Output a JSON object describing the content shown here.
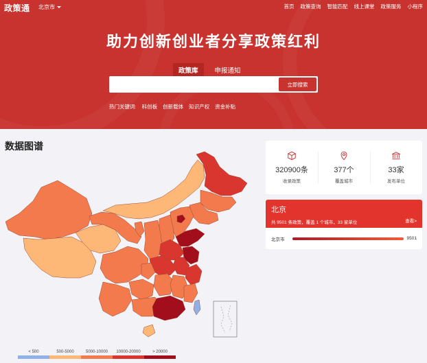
{
  "header": {
    "logo": "政策通",
    "city": "北京市",
    "nav": [
      "首页",
      "政策查询",
      "智能匹配",
      "线上课堂",
      "政策服务",
      "小程序"
    ],
    "headline": "助力创新创业者分享政策红利",
    "tabs": [
      {
        "label": "政策库",
        "active": true
      },
      {
        "label": "申报通知",
        "active": false
      }
    ],
    "search": {
      "value": "",
      "placeholder": "",
      "button": "立即搜索"
    },
    "hot_label": "热门关键词:",
    "hot_keywords": [
      "科创板",
      "创新载体",
      "知识产权",
      "资金补贴"
    ]
  },
  "section_title": "数据图谱",
  "stats": [
    {
      "icon": "cube-icon",
      "value": "320900条",
      "caption": "收录政策"
    },
    {
      "icon": "location-pin-icon",
      "value": "377个",
      "caption": "覆盖城市"
    },
    {
      "icon": "bank-building-icon",
      "value": "33家",
      "caption": "发布单位"
    }
  ],
  "region": {
    "name": "北京",
    "desc": "共 9501 条政策，覆盖 1 个城市，33 家单位",
    "more": "查看>",
    "rows": [
      {
        "city": "北京市",
        "value": "9501",
        "fill": 1.0
      }
    ]
  },
  "legend": [
    {
      "label": "< 500",
      "color": "#8fb1e8"
    },
    {
      "label": "500-5000",
      "color": "#fdb777"
    },
    {
      "label": "5000-10000",
      "color": "#f27a4c"
    },
    {
      "label": "10000-20000",
      "color": "#d8362f"
    },
    {
      "label": "> 20000",
      "color": "#a30e1c"
    }
  ],
  "colors": {
    "brand": "#c8332f",
    "banner": "#e2332c",
    "background": "#f3f2f7"
  }
}
